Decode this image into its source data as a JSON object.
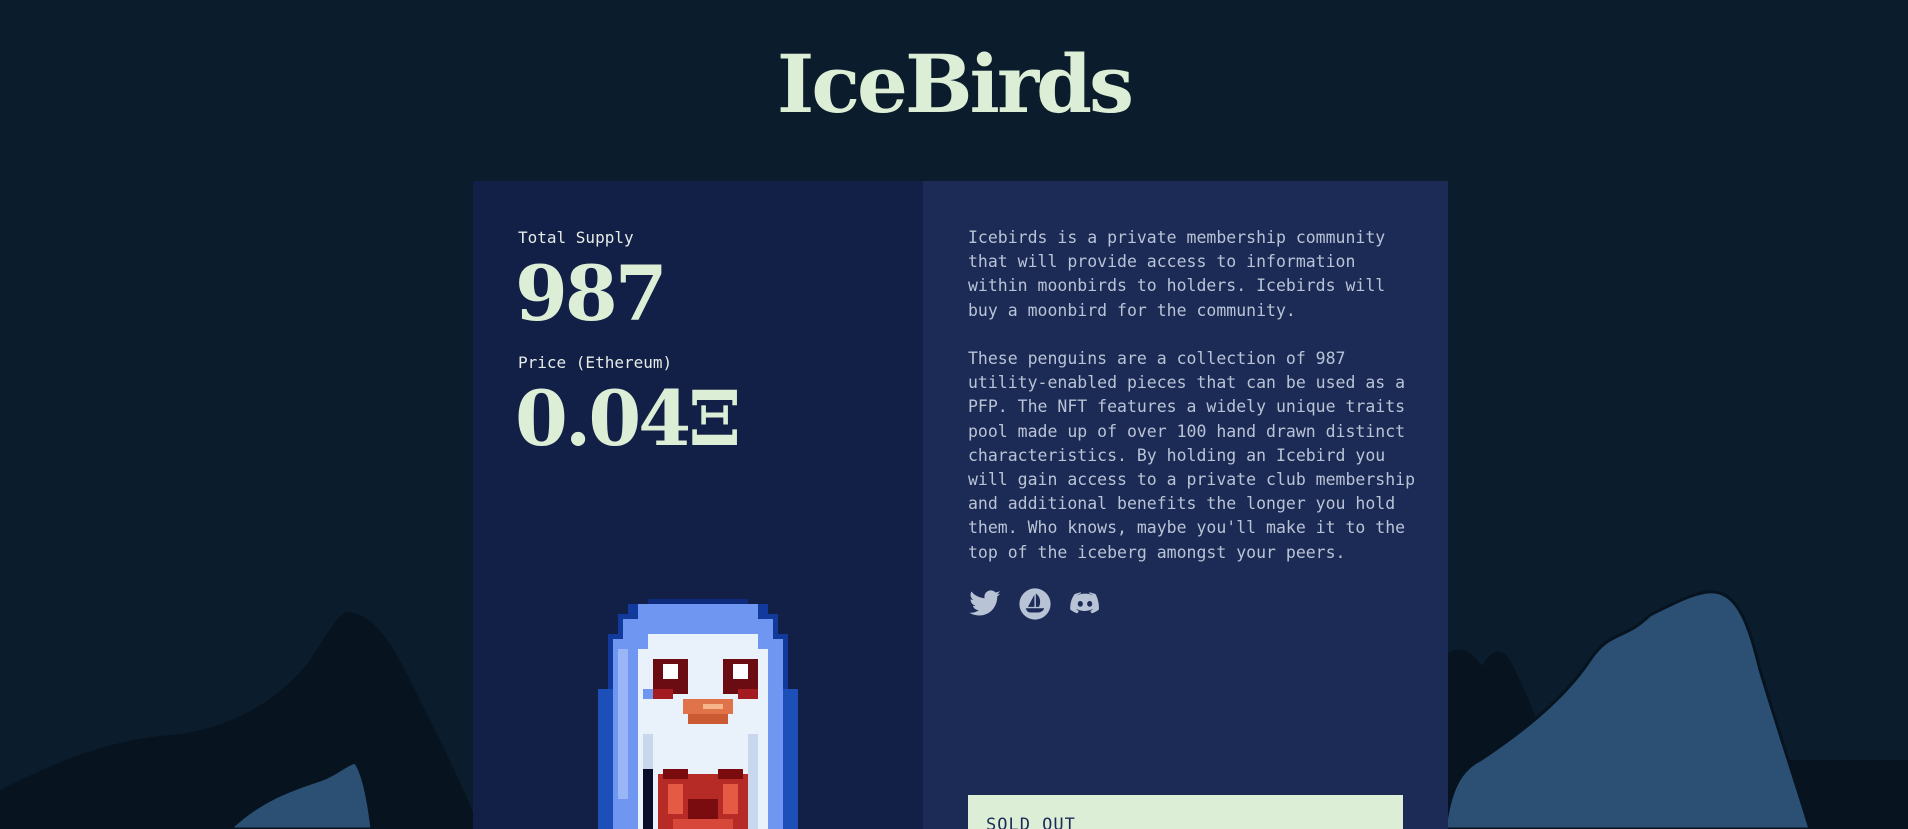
{
  "site": {
    "title": "IceBirds"
  },
  "stats": {
    "supply_label": "Total Supply",
    "supply_value": "987",
    "price_label": "Price (Ethereum)",
    "price_value": "0.04Ξ"
  },
  "about": {
    "paragraph_1": "Icebirds is a private membership community\nthat will provide access to information\nwithin moonbirds to holders. Icebirds will\nbuy a moonbird for the community.",
    "paragraph_2": "These penguins are a collection of 987\nutility-enabled pieces that can be used as a\nPFP. The NFT features a widely unique traits\npool made up of over 100 hand drawn distinct\ncharacteristics. By holding an Icebird you\nwill gain access to a private club membership\nand additional benefits the longer you hold\nthem. Who knows, maybe you'll make it to the\ntop of the iceberg amongst your peers."
  },
  "socials": [
    {
      "icon": "twitter-icon"
    },
    {
      "icon": "opensea-icon"
    },
    {
      "icon": "discord-icon"
    }
  ],
  "mint": {
    "button_label": "SOLD OUT"
  },
  "colors": {
    "page_bg": "#0b1c2c",
    "title": "#dcefd6",
    "card_left": "#121f46",
    "card_right": "#1c2b56",
    "mountain_dark": "#07131f",
    "mountain_light": "#2b5074",
    "button_bg": "#dcefd6"
  }
}
